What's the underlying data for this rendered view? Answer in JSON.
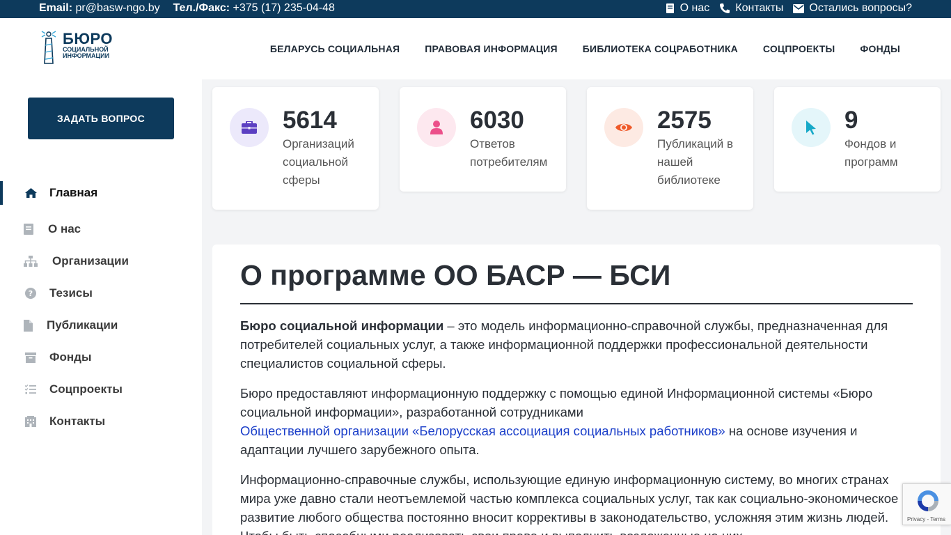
{
  "topbar": {
    "email_label": "Email:",
    "email_value": "pr@basw-ngo.by",
    "phone_label": "Тел./Факс:",
    "phone_value": "+375 (17) 235-04-48",
    "links": [
      "О нас",
      "Контакты",
      "Остались вопросы?"
    ]
  },
  "logo": {
    "big": "БЮРО",
    "line1": "социальной",
    "line2": "информации"
  },
  "nav": [
    "БЕЛАРУСЬ СОЦИАЛЬНАЯ",
    "ПРАВОВАЯ ИНФОРМАЦИЯ",
    "БИБЛИОТЕКА СОЦРАБОТНИКА",
    "СОЦПРОЕКТЫ",
    "ФОНДЫ"
  ],
  "sidebar": {
    "ask_button": "ЗАДАТЬ ВОПРОС",
    "items": [
      {
        "label": "Главная",
        "icon": "home-icon"
      },
      {
        "label": "О нас",
        "icon": "book-icon"
      },
      {
        "label": "Организации",
        "icon": "sitemap-icon"
      },
      {
        "label": "Тезисы",
        "icon": "question-circle-icon"
      },
      {
        "label": "Публикации",
        "icon": "file-icon"
      },
      {
        "label": "Фонды",
        "icon": "archive-icon"
      },
      {
        "label": "Соцпроекты",
        "icon": "tasks-icon"
      },
      {
        "label": "Контакты",
        "icon": "building-icon"
      }
    ]
  },
  "stats": [
    {
      "number": "5614",
      "label": "Организаций социальной сферы",
      "icon": "briefcase-icon",
      "color": "#5b3fc2",
      "bg": "#ece9fb"
    },
    {
      "number": "6030",
      "label": "Ответов потребителям",
      "icon": "user-icon",
      "color": "#ec4f8a",
      "bg": "#fde8ef"
    },
    {
      "number": "2575",
      "label": "Публикаций в нашей библиотеке",
      "icon": "eye-icon",
      "color": "#ef5a2a",
      "bg": "#fdeae3"
    },
    {
      "number": "9",
      "label": "Фондов и программ",
      "icon": "cursor-icon",
      "color": "#17a9c8",
      "bg": "#e4f6fa"
    }
  ],
  "main": {
    "title": "О программе ОО БАСР — БСИ",
    "p1_bold": "Бюро социальной информации",
    "p1_rest": " – это модель информационно-справочной службы, предназначенная для потребителей социальных услуг, а также информационной поддержки профессиональной деятельности специалистов социальной сферы.",
    "p2_start": "Бюро предоставляют информационную поддержку с помощью единой Информационной системы «Бюро социальной информации», разработанной сотрудниками ",
    "p2_link": "Общественной организации «Белорусская ассоциация социальных работников»",
    "p2_end": " на основе изучения и адаптации лучшего зарубежного опыта.",
    "p3": "Информационно-справочные службы, использующие единую информационную систему, во многих странах мира уже давно стали неотъемлемой частью комплекса социальных услуг, так как социально-экономическое развитие любого общества постоянно вносит коррективы в законодательство, усложняя этим жизнь людей. Чтобы быть способными реализовать свои права и выполнить возложенные на них"
  },
  "recaptcha": {
    "text": "Privacy - Terms"
  }
}
